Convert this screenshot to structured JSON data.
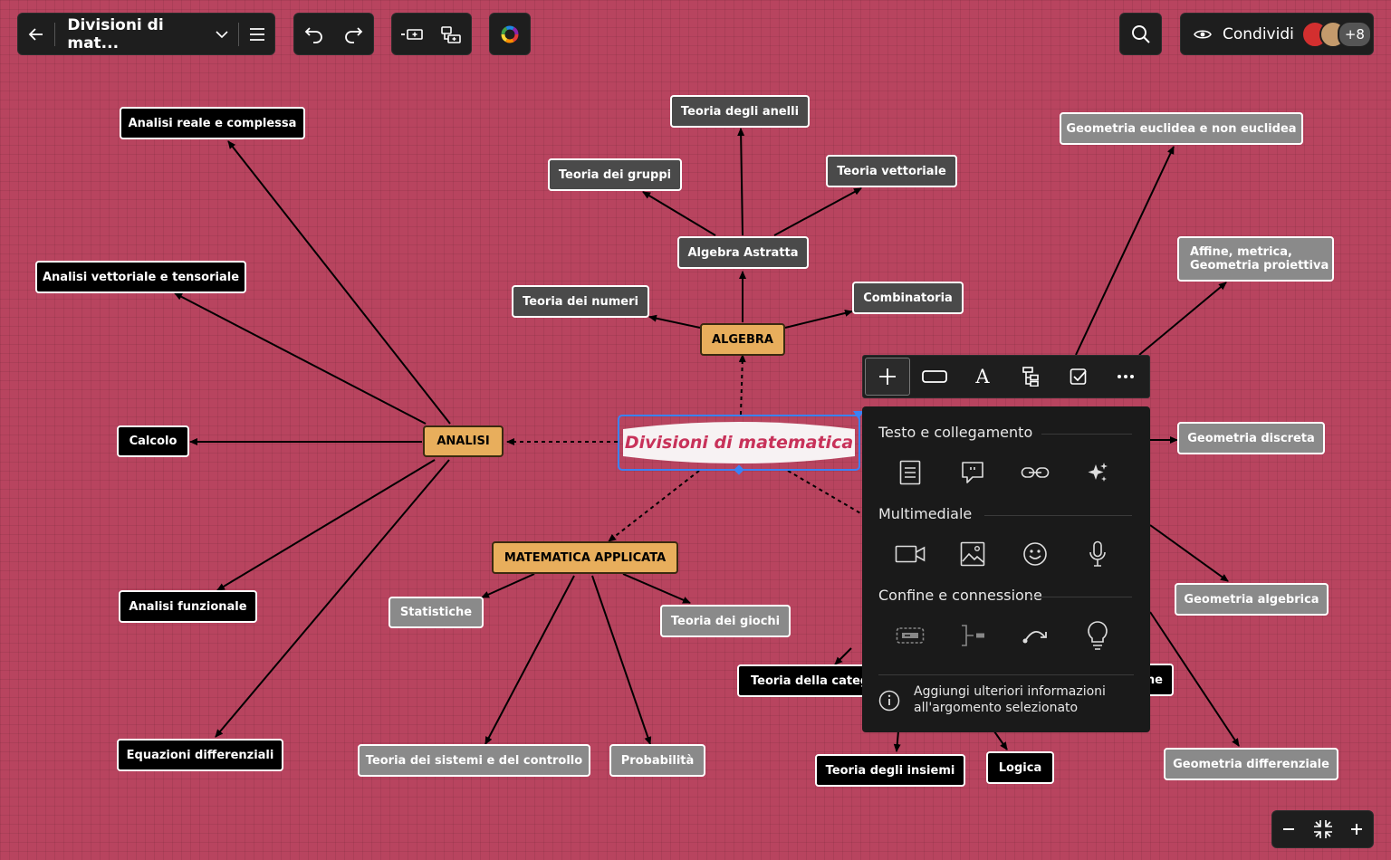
{
  "toolbar": {
    "doc_title": "Divisioni di mat...",
    "share_label": "Condividi",
    "collaborators_more": "+8"
  },
  "central": {
    "title": "Divisioni di matematica"
  },
  "categories": {
    "analisi": "ANALISI",
    "algebra": "ALGEBRA",
    "applicata": "MATEMATICA APPLICATA"
  },
  "topics": {
    "analisi_reale": "Analisi reale e complessa",
    "analisi_vettoriale": "Analisi vettoriale e tensoriale",
    "calcolo": "Calcolo",
    "analisi_funzionale": "Analisi funzionale",
    "equazioni_diff": "Equazioni differenziali",
    "teoria_anelli": "Teoria degli anelli",
    "teoria_gruppi": "Teoria dei gruppi",
    "teoria_vettoriale": "Teoria vettoriale",
    "algebra_astratta": "Algebra Astratta",
    "teoria_numeri": "Teoria dei numeri",
    "combinatoria": "Combinatoria",
    "statistiche": "Statistiche",
    "teoria_giochi": "Teoria dei giochi",
    "teoria_sistemi": "Teoria dei sistemi e del controllo",
    "probabilita": "Probabilità",
    "teoria_categ": "Teoria della categ",
    "teoria_insiemi": "Teoria degli insiemi",
    "logica": "Logica",
    "ne_partial": "ne",
    "geom_euclidea": "Geometria euclidea e non euclidea",
    "affine_line1": "Affine, metrica,",
    "affine_line2": "Geometria proiettiva",
    "geom_discreta": "Geometria discreta",
    "geom_algebrica": "Geometria algebrica",
    "geom_differenziale": "Geometria differenziale"
  },
  "popup": {
    "section1": "Testo e collegamento",
    "section2": "Multimediale",
    "section3": "Confine e connessione",
    "info_line1": "Aggiungi ulteriori informazioni",
    "info_line2": "all'argomento selezionato"
  },
  "icons": {
    "back": "arrow-left-icon",
    "chevron": "chevron-down-icon",
    "menu": "hamburger-icon",
    "undo": "undo-icon",
    "redo": "redo-icon",
    "search": "search-icon",
    "eye": "eye-icon"
  },
  "colors": {
    "canvas": "#b8445f",
    "central_text": "#c8325a",
    "selection": "#3b82f6",
    "category": "#e8ae5c"
  }
}
